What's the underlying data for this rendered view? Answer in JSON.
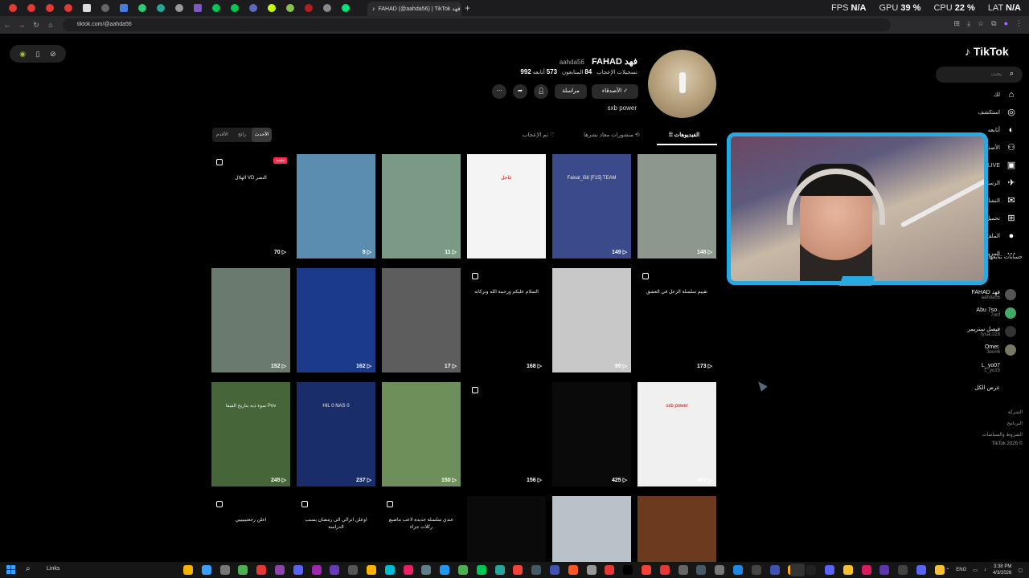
{
  "browser": {
    "active_tab_title": "FAHAD (@aahda56) | TikTok فهد",
    "url": "tiktok.com/@aahda56",
    "new_tab_symbol": "+",
    "close_tab_symbol": "×"
  },
  "perf": {
    "fps_label": "FPS",
    "fps_value": "N/A",
    "gpu_label": "GPU",
    "gpu_value": "39 %",
    "cpu_label": "CPU",
    "cpu_value": "22 %",
    "lat_label": "LAT",
    "lat_value": "N/A"
  },
  "tiktok": {
    "logo": "TikTok",
    "search_placeholder": "بحث",
    "nav": [
      "لك",
      "استكشف",
      "أتابعه",
      "الأصدقاء",
      "LIVE",
      "الرسائل",
      "النشاط",
      "تحميل",
      "الملف الشخصي",
      "المزيد"
    ],
    "following_title": "حسابات تتابعها",
    "following": [
      {
        "name": "FAHAD فهد",
        "handle": "aahda56"
      },
      {
        "name": "Abu 7so .",
        "handle": "7onf"
      },
      {
        "name": "فيصل ستريمر",
        "handle": "fysal.223"
      },
      {
        "name": "Omer.",
        "handle": "3enn6"
      },
      {
        "name": "L_yo07",
        "handle": "L_yo15"
      }
    ],
    "see_all": "عرض الكل",
    "footer": [
      "الشركة",
      "البرنامج",
      "الشروط والسياسات",
      "TikTok 2026 ©"
    ]
  },
  "profile": {
    "name": "FAHAD فهد",
    "handle": "aahda56",
    "following_count": "573",
    "following_label": "أتابعه",
    "followers_count": "84",
    "followers_label": "المتابعون",
    "likes_count": "992",
    "likes_label": "تسجيلات الإعجاب",
    "friends_button": "الأصدقاء ✓",
    "message_button": "مراسلة",
    "bio": "sxb power"
  },
  "tabs": {
    "videos": "الفيديوهات",
    "reposts": "منشورات معاد نشرها",
    "liked": "تم الإعجاب",
    "sort": [
      "الأحدث",
      "رائج",
      "الأقدم"
    ]
  },
  "videos": [
    {
      "views": "148",
      "caption": "",
      "bg": "#8d978d"
    },
    {
      "views": "149",
      "caption": "Faisal_i56 [F15] TEAM",
      "bg": "#3b4a8a"
    },
    {
      "views": "",
      "caption": "عاجل",
      "bg": "#f4f4f4"
    },
    {
      "views": "11",
      "caption": "",
      "bg": "#7a9a86"
    },
    {
      "views": "8",
      "caption": "",
      "bg": "#5a8db0"
    },
    {
      "views": "70",
      "caption": "النصر VD الهلال",
      "bg": "#000000",
      "badge": "مثبت"
    },
    {
      "views": "173",
      "caption": "تقييم سلسلة الزعل في العشق",
      "bg": "#000000"
    },
    {
      "views": "99",
      "caption": "",
      "bg": "#c8c8c8"
    },
    {
      "views": "168",
      "caption": "السلام عليكم ورحمة الله وبركاته",
      "bg": "#000000"
    },
    {
      "views": "17",
      "caption": "",
      "bg": "#5d5d5d"
    },
    {
      "views": "162",
      "caption": "",
      "bg": "#1c3a8c"
    },
    {
      "views": "152",
      "caption": "",
      "bg": "#6b7a6e"
    },
    {
      "views": "403",
      "caption": "sxb power",
      "bg": "#f0f0f0"
    },
    {
      "views": "425",
      "caption": "",
      "bg": "#0a0a0a"
    },
    {
      "views": "156",
      "caption": "",
      "bg": "#000000"
    },
    {
      "views": "150",
      "caption": "",
      "bg": "#6f8f5a"
    },
    {
      "views": "237",
      "caption": "HIL 0 NAS 0",
      "bg": "#1a2d6b"
    },
    {
      "views": "245",
      "caption": "Pov سوء ذبه بتاريخ الفيفا",
      "bg": "#46663a"
    },
    {
      "views": "",
      "caption": "",
      "bg": "#6b3a1f"
    },
    {
      "views": "",
      "caption": "",
      "bg": "#b9c2c9"
    },
    {
      "views": "",
      "caption": "",
      "bg": "#0a0a0a"
    },
    {
      "views": "",
      "caption": "عندي سلسلة جديدة لاعب ماضيع ركلات جزاء",
      "bg": "#000000"
    },
    {
      "views": "",
      "caption": "اوعلن اتزالي الى رمضان بسبب الدراسة",
      "bg": "#000000"
    },
    {
      "views": "",
      "caption": "اعلن رجعتيييييي",
      "bg": "#000000"
    }
  ],
  "taskbar": {
    "links_label": "Links",
    "lang": "ENG",
    "time": "3:38 PM",
    "date": "4/3/2026"
  },
  "colors": {
    "tiktok_red": "#fe2c55",
    "facecam_border": "#29a9e0"
  }
}
